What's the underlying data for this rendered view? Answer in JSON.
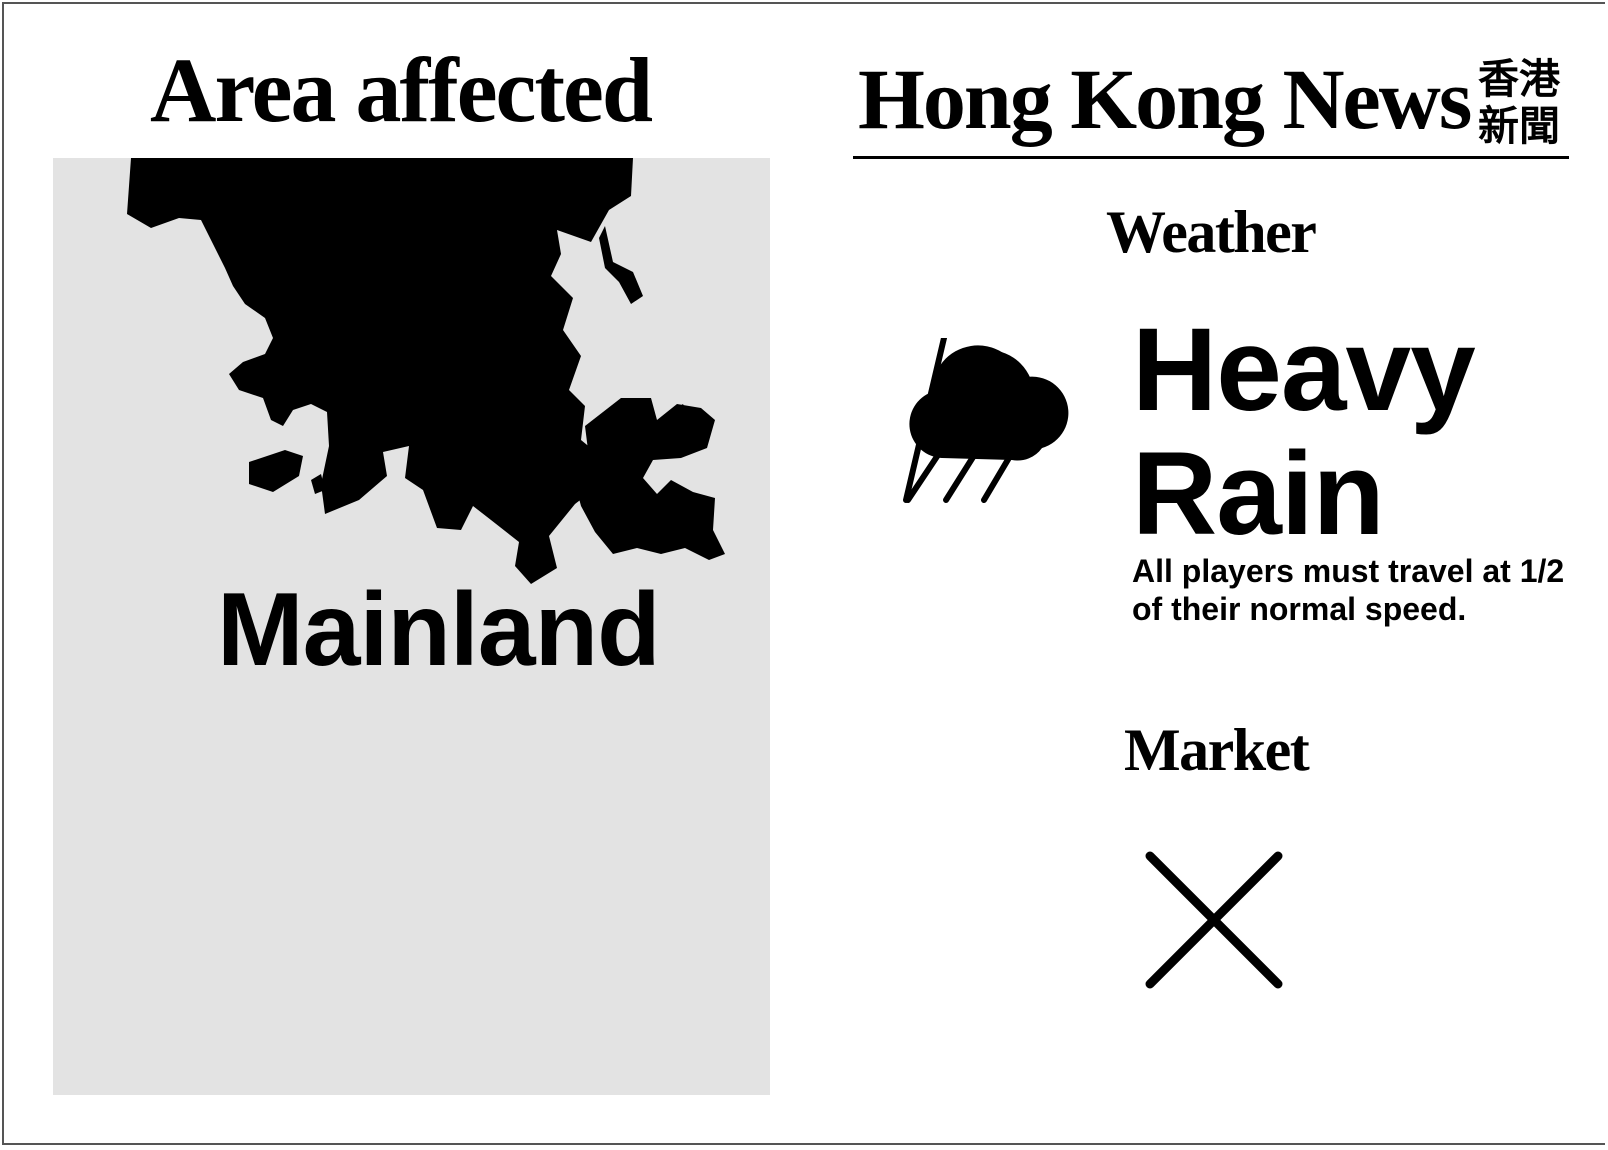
{
  "area": {
    "title": "Area affected",
    "name": "Mainland",
    "map_icon": "hong-kong-map-silhouette"
  },
  "news": {
    "title": "Hong Kong News",
    "title_chinese_line1": "香港",
    "title_chinese_line2": "新聞"
  },
  "weather": {
    "heading": "Weather",
    "icon": "rain-cloud-icon",
    "name_line1": "Heavy",
    "name_line2": "Rain",
    "description": "All players must travel at 1/2 of their normal speed."
  },
  "market": {
    "heading": "Market",
    "icon": "cross-icon"
  },
  "colors": {
    "panel": "#e3e3e3",
    "ink": "#000000",
    "background": "#ffffff"
  }
}
